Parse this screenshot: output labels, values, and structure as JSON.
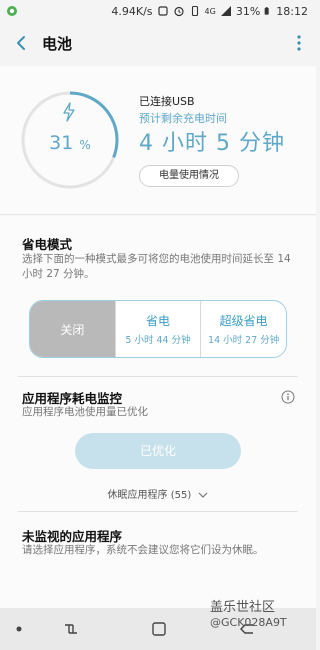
{
  "status_bar": {
    "net_speed": "4.94K/s",
    "network": "4G",
    "battery": "31%",
    "time": "18:12"
  },
  "header": {
    "title": "电池"
  },
  "battery": {
    "percent": "31",
    "percent_unit": "%",
    "connection": "已连接USB",
    "remaining_label": "预计剩余充电时间",
    "remaining_time": "4 小时 5 分钟",
    "usage_button": "电量使用情况",
    "level_fraction": 0.31
  },
  "power_mode": {
    "title": "省电模式",
    "description": "选择下面的一种模式最多可将您的电池使用时间延长至 14 小时 27 分钟。",
    "options": [
      {
        "name": "关闭",
        "sub": ""
      },
      {
        "name": "省电",
        "sub": "5 小时 44 分钟"
      },
      {
        "name": "超级省电",
        "sub": "14 小时 27 分钟"
      }
    ]
  },
  "app_monitor": {
    "title": "应用程序耗电监控",
    "description": "应用程序电池使用量已优化",
    "button": "已优化",
    "sleeping_apps": "休眠应用程序 (55)"
  },
  "unmonitored": {
    "title": "未监视的应用程序",
    "description": "请选择应用程序，系统不会建议您将它们设为休眠。"
  },
  "watermark": {
    "line1": "盖乐世社区",
    "line2": "@GCK028A9T"
  },
  "colors": {
    "accent": "#5fa8c8",
    "ring_track": "#e3e3e3"
  }
}
